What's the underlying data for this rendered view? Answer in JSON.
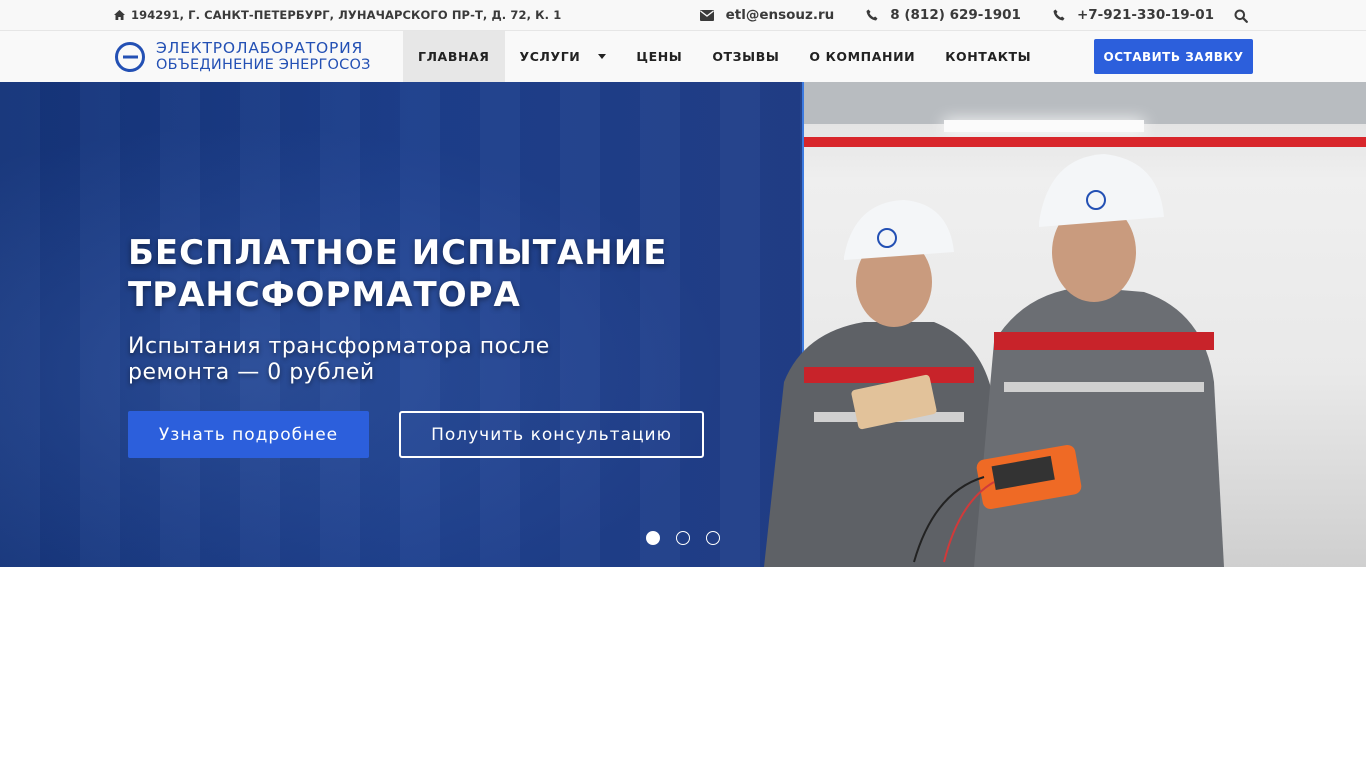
{
  "topbar": {
    "address": "194291, Г. САНКТ-ПЕТЕРБУРГ, ЛУНАЧАРСКОГО ПР-Т, Д. 72, К. 1",
    "email": "etl@ensouz.ru",
    "phone1": "8 (812) 629-1901",
    "phone2": "+7-921-330-19-01"
  },
  "logo": {
    "line1": "ЭЛЕКТРОЛАБОРАТОРИЯ",
    "line2": "ОБЪЕДИНЕНИЕ ЭНЕРГОСОЗ"
  },
  "nav": {
    "items": [
      {
        "label": "ГЛАВНАЯ"
      },
      {
        "label": "УСЛУГИ"
      },
      {
        "label": "ЦЕНЫ"
      },
      {
        "label": "ОТЗЫВЫ"
      },
      {
        "label": "О КОМПАНИИ"
      },
      {
        "label": "КОНТАКТЫ"
      }
    ],
    "cta_label": "ОСТАВИТЬ ЗАЯВКУ"
  },
  "hero": {
    "title_line1": "БЕСПЛАТНОЕ ИСПЫТАНИЕ",
    "title_line2": "ТРАНСФОРМАТОРА",
    "subtitle": "Испытания трансформатора после ремонта — 0 рублей",
    "primary_button": "Узнать подробнее",
    "secondary_button": "Получить консультацию",
    "slides_count": 3,
    "active_slide": 1
  },
  "colors": {
    "accent": "#2c5fdc",
    "brand_blue": "#2350b4",
    "hero_bg": "#1d3f8c"
  },
  "icons": {
    "address": "home-icon",
    "email": "envelope-icon",
    "phone": "phone-icon",
    "search": "search-icon"
  }
}
